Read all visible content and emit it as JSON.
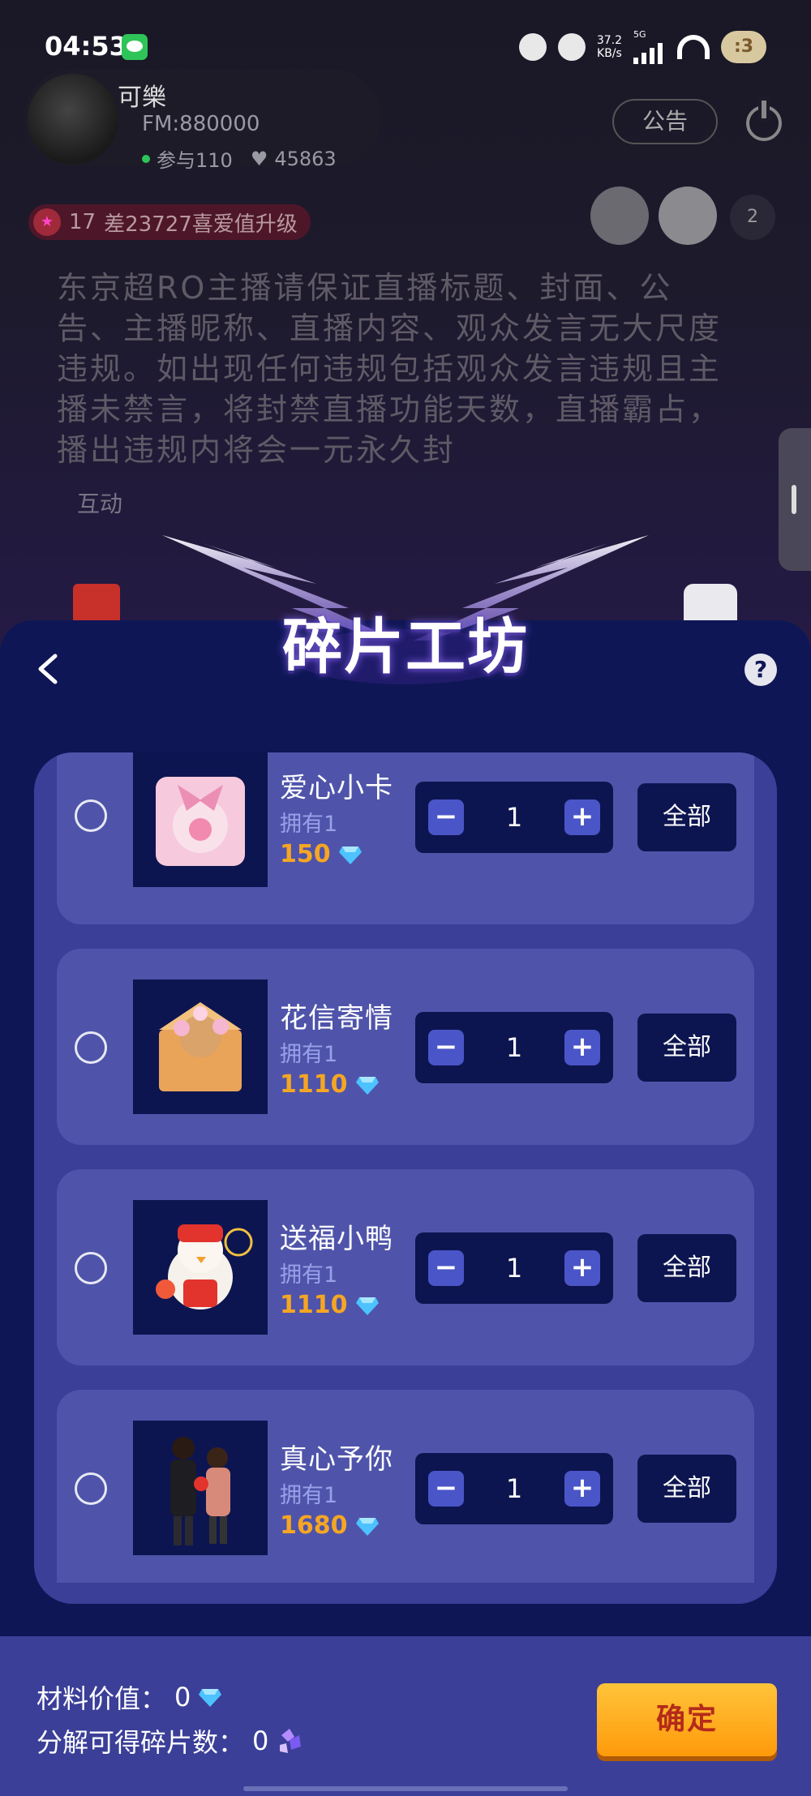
{
  "status_bar": {
    "time": "04:53",
    "network_speed": "37.2\nKB/s",
    "network_type": "5G",
    "icons": [
      "wechat-icon",
      "mushroom-icon",
      "cat-icon",
      "signal-icon",
      "wifi-icon",
      "avatar-badge-icon"
    ]
  },
  "room": {
    "host_name": "可樂",
    "host_id": "FM:880000",
    "participants": "参与110",
    "likes": "45863",
    "notice_button": "公告",
    "level_badge": "17",
    "level_text": "差23727喜爱值升级",
    "viewer_count": "2",
    "rules": "东京超RO主播请保证直播标题、封面、公告、主播昵称、直播内容、观众发言无大尺度违规。如出现任何违规包括观众发言违规且主播未禁言，将封禁直播功能天数，直播霸占，播出违规内将会一元永久封",
    "interact_label": "互动"
  },
  "panel": {
    "title": "碎片工坊",
    "help_label": "?",
    "accent_color": "#0f1656",
    "items": [
      {
        "name": "爱心小卡",
        "owned": "拥有1",
        "price": "150",
        "quantity": "1",
        "all_label": "全部"
      },
      {
        "name": "花信寄情",
        "owned": "拥有1",
        "price": "1110",
        "quantity": "1",
        "all_label": "全部"
      },
      {
        "name": "送福小鸭",
        "owned": "拥有1",
        "price": "1110",
        "quantity": "1",
        "all_label": "全部"
      },
      {
        "name": "真心予你",
        "owned": "拥有1",
        "price": "1680",
        "quantity": "1",
        "all_label": "全部"
      }
    ],
    "footer": {
      "material_value_label": "材料价值：",
      "material_value": "0",
      "shards_label": "分解可得碎片数：",
      "shards": "0",
      "confirm_label": "确定"
    }
  }
}
